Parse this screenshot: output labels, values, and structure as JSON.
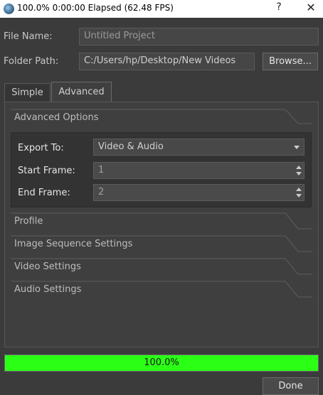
{
  "window": {
    "title": "100.0%  0:00:00 Elapsed (62.48 FPS)",
    "help_glyph": "?",
    "close_glyph": "✕"
  },
  "file_name": {
    "label": "File Name:",
    "value": "Untitled Project"
  },
  "folder_path": {
    "label": "Folder Path:",
    "value": "C:/Users/hp/Desktop/New Videos",
    "browse_label": "Browse..."
  },
  "tabs": [
    {
      "label": "Simple",
      "active": false
    },
    {
      "label": "Advanced",
      "active": true
    }
  ],
  "advanced_options": {
    "header": "Advanced Options",
    "export_to": {
      "label": "Export To:",
      "value": "Video & Audio"
    },
    "start_frame": {
      "label": "Start Frame:",
      "value": "1"
    },
    "end_frame": {
      "label": "End Frame:",
      "value": "2"
    }
  },
  "sections": [
    {
      "label": "Profile"
    },
    {
      "label": "Image Sequence Settings"
    },
    {
      "label": "Video Settings"
    },
    {
      "label": "Audio Settings"
    }
  ],
  "progress": {
    "fraction": 1.0,
    "text": "100.0%",
    "color": "#2bff15"
  },
  "done_label": "Done"
}
